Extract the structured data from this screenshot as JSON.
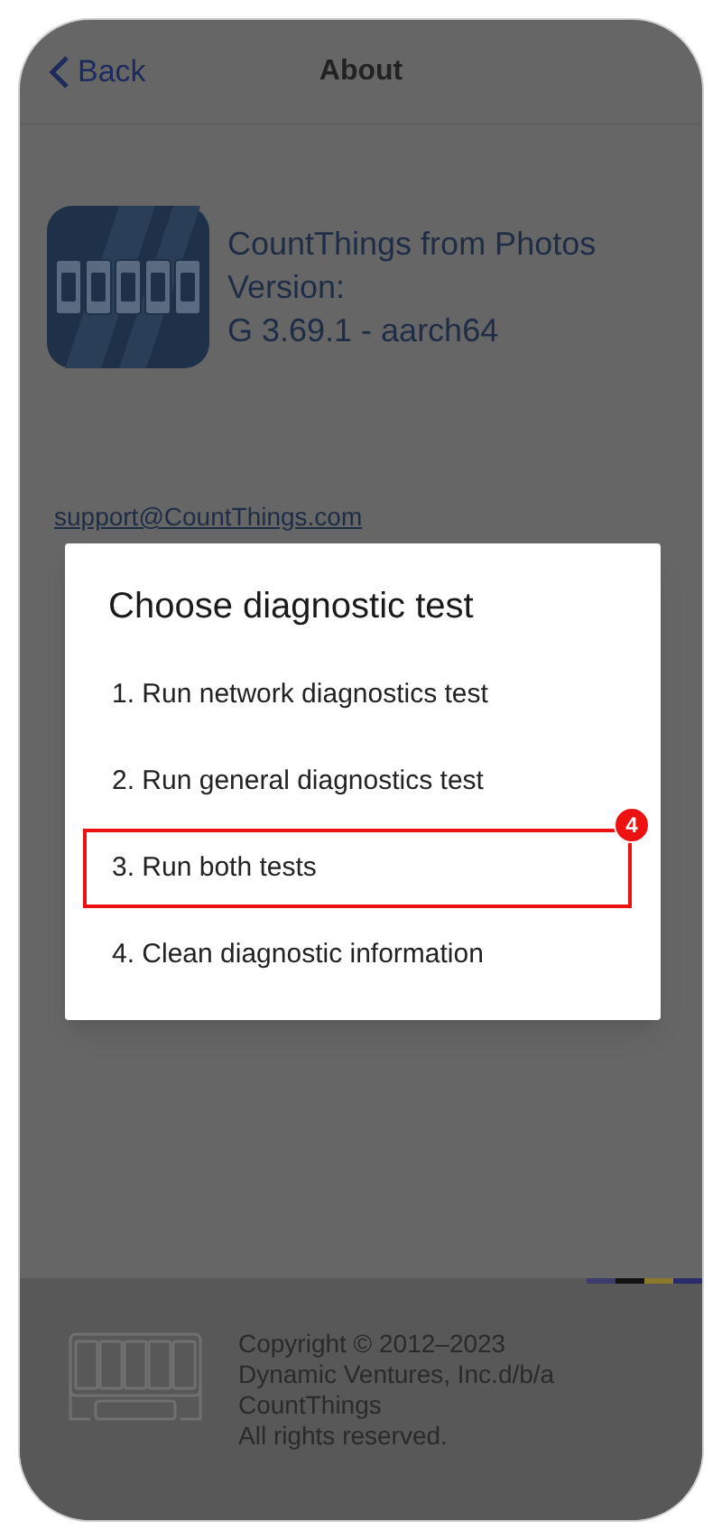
{
  "header": {
    "back": "Back",
    "title": "About"
  },
  "app": {
    "name": "CountThings from Photos",
    "version_label": "Version:",
    "version": "G 3.69.1 - aarch64"
  },
  "links": [
    {
      "text": "support@CountThings.com",
      "kind": "link"
    }
  ],
  "dialog": {
    "title": "Choose diagnostic test",
    "options": [
      {
        "label": "1. Run network diagnostics test",
        "highlighted": false
      },
      {
        "label": "2. Run general diagnostics test",
        "highlighted": false
      },
      {
        "label": "3. Run both tests",
        "highlighted": true
      },
      {
        "label": "4. Clean diagnostic information",
        "highlighted": false
      }
    ],
    "callout": "4"
  },
  "footer": {
    "lines": [
      "Copyright © 2012–2023",
      "Dynamic Ventures, Inc.d/b/a",
      "CountThings",
      "All rights reserved."
    ]
  }
}
